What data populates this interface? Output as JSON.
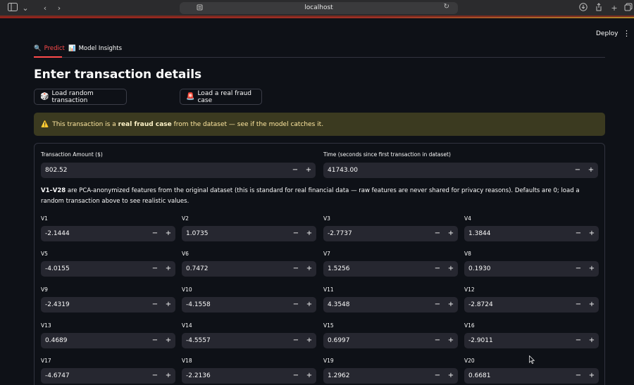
{
  "browser": {
    "url": "localhost",
    "icons": [
      "sidebar-icon",
      "chevron-down-icon",
      "back-icon",
      "forward-icon",
      "site-info-icon",
      "reload-icon",
      "download-icon",
      "share-icon",
      "new-tab-icon",
      "tabs-overview-icon"
    ]
  },
  "header": {
    "deploy_label": "Deploy"
  },
  "tabs": [
    {
      "label": "Predict",
      "icon": "magnifier-icon",
      "active": true
    },
    {
      "label": "Model Insights",
      "icon": "bar-chart-icon",
      "active": false
    }
  ],
  "main": {
    "title": "Enter transaction details",
    "buttons": {
      "random_label": "Load random transaction",
      "random_icon": "🎲",
      "fraud_label": "Load a real fraud case",
      "fraud_icon": "🚨"
    },
    "alert": {
      "icon": "⚠️",
      "pre": "This transaction is a ",
      "bold": "real fraud case",
      "post": " from the dataset — see if the model catches it."
    },
    "amount": {
      "label": "Transaction Amount ($)",
      "value": "802.52"
    },
    "time": {
      "label": "Time (seconds since first transaction in dataset)",
      "value": "41743.00"
    },
    "description": {
      "bold": "V1–V28",
      "text": " are PCA-anonymized features from the original dataset (this is standard for real financial data — raw features are never shared for privacy reasons). Defaults are 0; load a random transaction above to see realistic values."
    },
    "minus": "−",
    "plus": "+",
    "features": [
      {
        "label": "V1",
        "value": "-2.1444"
      },
      {
        "label": "V2",
        "value": "1.0735"
      },
      {
        "label": "V3",
        "value": "-2.7737"
      },
      {
        "label": "V4",
        "value": "1.3844"
      },
      {
        "label": "V5",
        "value": "-4.0155"
      },
      {
        "label": "V6",
        "value": "0.7472"
      },
      {
        "label": "V7",
        "value": "1.5256"
      },
      {
        "label": "V8",
        "value": "0.1930"
      },
      {
        "label": "V9",
        "value": "-2.4319"
      },
      {
        "label": "V10",
        "value": "-4.1558"
      },
      {
        "label": "V11",
        "value": "4.3548"
      },
      {
        "label": "V12",
        "value": "-2.8724"
      },
      {
        "label": "V13",
        "value": "0.4689"
      },
      {
        "label": "V14",
        "value": "-4.5557"
      },
      {
        "label": "V15",
        "value": "0.6997"
      },
      {
        "label": "V16",
        "value": "-2.9011"
      },
      {
        "label": "V17",
        "value": "-4.6747"
      },
      {
        "label": "V18",
        "value": "-2.2136"
      },
      {
        "label": "V19",
        "value": "1.2962"
      },
      {
        "label": "V20",
        "value": "0.6681"
      }
    ]
  }
}
